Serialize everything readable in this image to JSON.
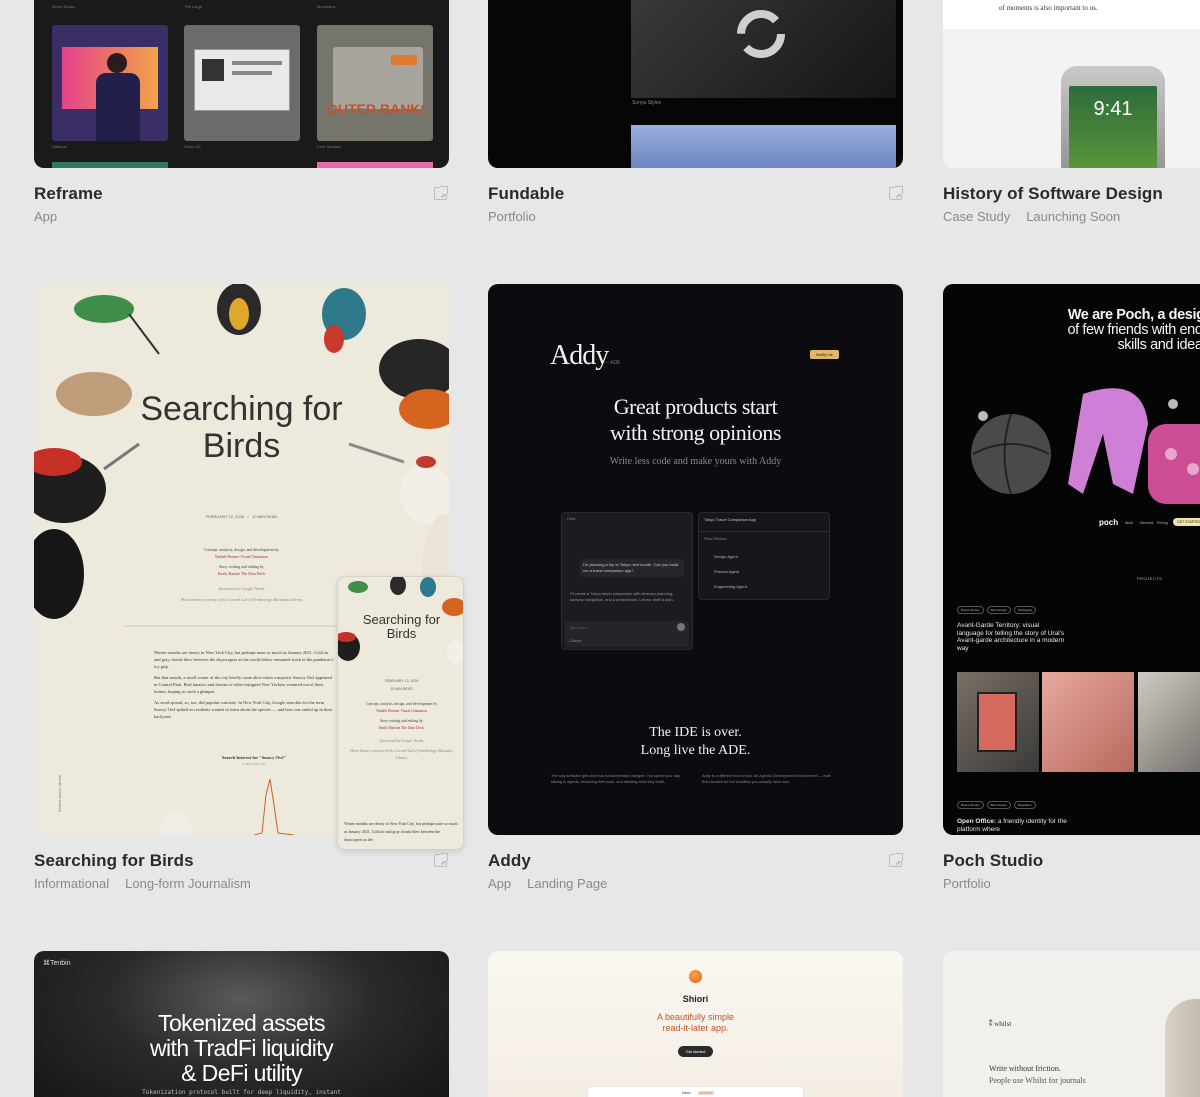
{
  "cards": {
    "reframe": {
      "title": "Reframe",
      "tags": [
        "App"
      ],
      "preview": {
        "labels_top": [
          "Movie Studio",
          "The Large",
          "Mountains"
        ],
        "labels_bottom": [
          "Halftone",
          "Stone 2D",
          "Fern Shadow"
        ],
        "thumb_text": "OUTER BANKS"
      }
    },
    "fundable": {
      "title": "Fundable",
      "tags": [
        "Portfolio"
      ],
      "preview": {
        "caption": "Sonya Styles"
      }
    },
    "history": {
      "title": "History of Software Design",
      "tags": [
        "Case Study",
        "Launching Soon"
      ],
      "preview": {
        "text": "of moments is also important to us.",
        "time": "9:41"
      }
    },
    "birds": {
      "title": "Searching for Birds",
      "tags": [
        "Informational",
        "Long-form Journalism"
      ],
      "preview": {
        "headline_line1": "Searching for",
        "headline_line2": "Birds",
        "date": "FEBRUARY 12, 2026",
        "read": "10 MIN READ",
        "credit1": "Concept, analysis, design, and development by",
        "credit1_names": "Nadieh Bremer  Visual Cinnamon",
        "credit2": "Story writing and editing by",
        "credit2_names": "Emily Barone  The Data Deck",
        "sponsor": "Sponsored by Google Trends",
        "photo_credit": "Photo library courtesy of the Cornell Lab of Ornithology  Macaulay Library",
        "body": "Winter months are dreary in New York City, but perhaps none so much as January 2021. Cold air and gray clouds blew between the skyscrapers as the world below remained stuck in the pandemic's icy grip.",
        "body2": "But that month, a small corner of the city briefly came alive when a majestic Snowy Owl appeared in Central Park. Bird fanatics and dozens of other intrigued New Yorkers ventured out of their homes, hoping to catch a glimpse.",
        "body3": "As word spread, so, too, did popular curiosity. In New York City, Google searches for the term Snowy Owl spiked as residents wanted to learn about the species — and how one ended up in their backyard.",
        "chart_title": "Search Interest for \"Snowy Owl\"",
        "chart_sub": "in New York City",
        "y_label": "Relative search interest",
        "mobile_body": "Winter months are dreary in New York City, but perhaps none so much as January 2021. Cold air and gray clouds blew between the skyscrapers as the"
      }
    },
    "addy": {
      "title": "Addy",
      "tags": [
        "App",
        "Landing Page"
      ],
      "preview": {
        "logo": "Addy",
        "logo_sub": "— ADE",
        "notify": "Notify me",
        "headline_line1": "Great products start",
        "headline_line2": "with strong opinions",
        "subhead": "Write less code and make yours with Addy",
        "chat_label": "Chat",
        "chat_msg": "I'm planning a trip to Tokyo next month. Can you build me a travel companion app?",
        "chat_reply": "I'll create a Tokyo travel companion with itinerary planning, subway navigation, and a phrasebook. Let me draft a plan.",
        "chat_input": "Type here",
        "chat_model": "Claude",
        "app_name": "Tokyo Travel Companion App",
        "plan_review": "Plan Review",
        "agents": [
          "Design Agent",
          "Product Agent",
          "Engineering Agent"
        ],
        "tagline_line1": "The IDE is over.",
        "tagline_line2": "Long live the ADE.",
        "foot_left": "The way software gets built has fundamentally changed. You spend your day talking to agents, reviewing their work, and steering what they build.",
        "foot_right": "Addy is a different kind of tool. An Agentic Development Environment — built from scratch for the workflow you actually have now."
      }
    },
    "poch": {
      "title": "Poch Studio",
      "tags": [
        "Portfolio"
      ],
      "preview": {
        "headline_line1": "We are Poch, a design",
        "headline_line2": "of few friends with endle",
        "headline_line3": "skills and ideas.",
        "logo": "poch",
        "nav": [
          "Work",
          "Services",
          "Pricing"
        ],
        "cta": "GET STARTED",
        "projects": "PROJECTS",
        "chips1": [
          "Brand Identity",
          "Web Design",
          "Packaging"
        ],
        "project1": "Avant-Garde Territory: visual language for telling the story of Ural's Avant-garde architecture in a modern way",
        "chips2": [
          "Brand Identity",
          "Web Design",
          "Illustration"
        ],
        "project2_bold": "Open Office:",
        "project2": "a friendly identity for the platform where"
      }
    },
    "tenbin": {
      "preview": {
        "logo": "Tenbin",
        "headline_line1": "Tokenized assets",
        "headline_line2": "with TradFi liquidity",
        "headline_line3": "& DeFi utility",
        "sub": "Tokenization protocol built for deep liquidity, instant"
      }
    },
    "shiori": {
      "preview": {
        "name": "Shiori",
        "tagline_line1": "A beautifully simple",
        "tagline_line2": "read-it-later app.",
        "button": "Get started",
        "tabs": [
          "Inbox",
          "Archive"
        ]
      }
    },
    "whilst": {
      "preview": {
        "logo": "whilst",
        "line1": "Write without friction.",
        "line2": "People use Whilst for journals"
      }
    }
  }
}
